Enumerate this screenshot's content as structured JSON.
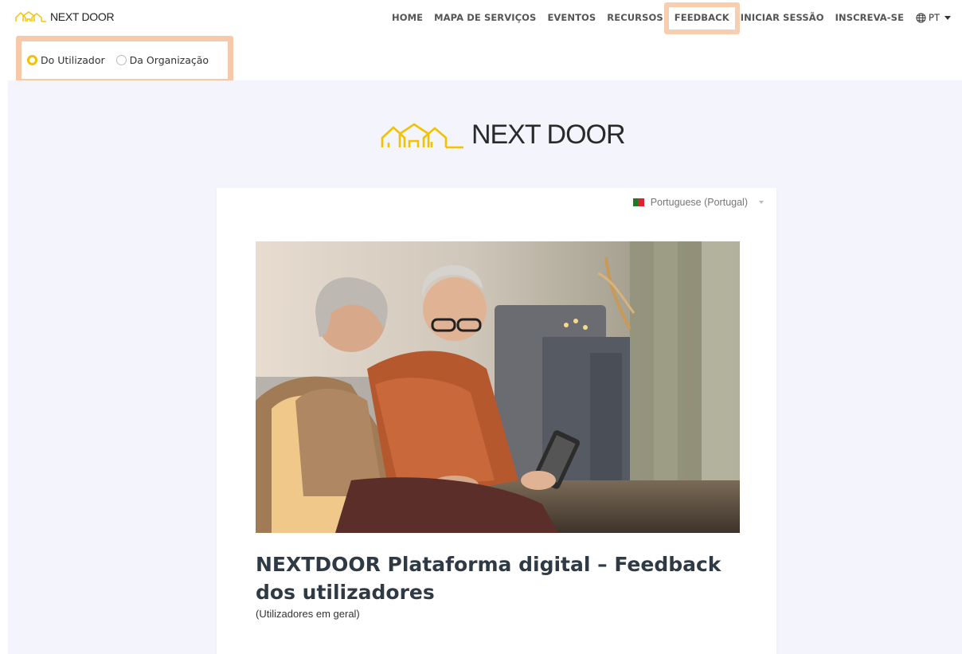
{
  "brand": {
    "name": "NEXT DOOR",
    "logo_color": "#f2c200"
  },
  "nav": {
    "items": [
      "HOME",
      "MAPA DE SERVIÇOS",
      "EVENTOS",
      "RECURSOS",
      "FEEDBACK",
      "INICIAR SESSÃO",
      "INSCREVA-SE"
    ],
    "language": "PT",
    "highlighted": "FEEDBACK"
  },
  "feedback_type": {
    "options": [
      "Do Utilizador",
      "Da Organização"
    ],
    "selected": "Do Utilizador"
  },
  "hero": {
    "logo_text": "NEXT DOOR"
  },
  "card": {
    "language_select": "Portuguese (Portugal)",
    "title": "NEXTDOOR Plataforma digital – Feedback dos utilizadores",
    "subtitle": "(Utilizadores em geral)"
  },
  "colors": {
    "accent": "#f2c200",
    "highlight": "#f4a56e",
    "hero_bg": "#f4f4fd",
    "title": "#2f3a44"
  }
}
